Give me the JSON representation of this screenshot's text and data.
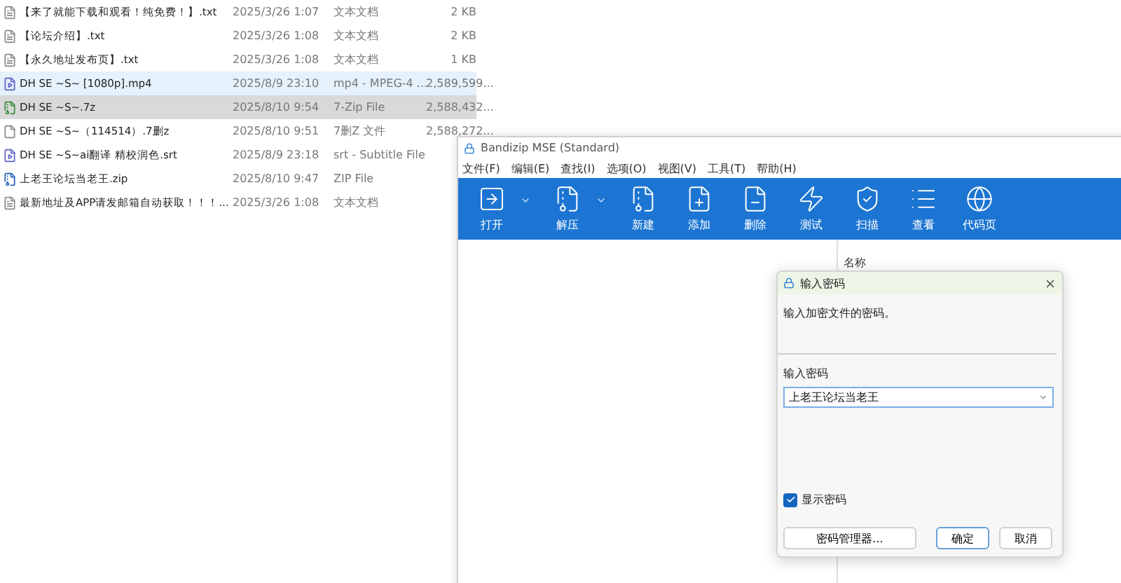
{
  "files": [
    {
      "kind": "text",
      "name": "【来了就能下载和观看！纯免费！】.txt",
      "date": "2025/3/26 1:07",
      "type": "文本文档",
      "size": "2 KB",
      "hovered": false,
      "selected": false
    },
    {
      "kind": "text",
      "name": "【论坛介绍】.txt",
      "date": "2025/3/26 1:08",
      "type": "文本文档",
      "size": "2 KB",
      "hovered": false,
      "selected": false
    },
    {
      "kind": "text",
      "name": "【永久地址发布页】.txt",
      "date": "2025/3/26 1:08",
      "type": "文本文档",
      "size": "1 KB",
      "hovered": false,
      "selected": false
    },
    {
      "kind": "video",
      "name": "DH SE ~S~ [1080p].mp4",
      "date": "2025/8/9 23:10",
      "type": "mp4 - MPEG-4 ...",
      "size": "2,589,599...",
      "hovered": true,
      "selected": false
    },
    {
      "kind": "archive",
      "name": "DH SE ~S~.7z",
      "date": "2025/8/10 9:54",
      "type": "7-Zip File",
      "size": "2,588,432...",
      "hovered": false,
      "selected": true
    },
    {
      "kind": "blank",
      "name": "DH SE ~S~（114514）.7删z",
      "date": "2025/8/10 9:51",
      "type": "7删Z 文件",
      "size": "2,588,272...",
      "hovered": false,
      "selected": false
    },
    {
      "kind": "video",
      "name": "DH SE ~S~ai翻译 精校润色.srt",
      "date": "2025/8/9 23:18",
      "type": "srt - Subtitle File",
      "hovered": false,
      "selected": false
    },
    {
      "kind": "zip",
      "name": "上老王论坛当老王.zip",
      "date": "2025/8/10 9:47",
      "type": "ZIP File",
      "hovered": false,
      "selected": false
    },
    {
      "kind": "text",
      "name": "最新地址及APP请发邮箱自动获取！！！...",
      "date": "2025/3/26 1:08",
      "type": "文本文档",
      "hovered": false,
      "selected": false
    }
  ],
  "bandizip": {
    "title": "Bandizip MSE (Standard)",
    "menu": [
      "文件(F)",
      "编辑(E)",
      "查找(I)",
      "选项(O)",
      "视图(V)",
      "工具(T)",
      "帮助(H)"
    ],
    "toolbar": [
      {
        "kind": "open",
        "label": "打开",
        "dropdown": true
      },
      {
        "kind": "extract",
        "label": "解压",
        "dropdown": true
      },
      {
        "kind": "new",
        "label": "新建",
        "dropdown": false
      },
      {
        "kind": "add",
        "label": "添加",
        "dropdown": false
      },
      {
        "kind": "delete",
        "label": "删除",
        "dropdown": false
      },
      {
        "kind": "test",
        "label": "测试",
        "dropdown": false
      },
      {
        "kind": "scan",
        "label": "扫描",
        "dropdown": false
      },
      {
        "kind": "view",
        "label": "查看",
        "dropdown": false
      },
      {
        "kind": "codepage",
        "label": "代码页",
        "dropdown": false
      }
    ],
    "column_header": "名称"
  },
  "dialog": {
    "title": "输入密码",
    "message": "输入加密文件的密码。",
    "field_label": "输入密码",
    "password": "上老王论坛当老王",
    "show_password": {
      "label": "显示密码",
      "checked": true
    },
    "buttons": [
      {
        "kind": "secondary",
        "label": "密码管理器..."
      },
      {
        "kind": "default",
        "label": "确定"
      },
      {
        "kind": "plain",
        "label": "取消"
      }
    ]
  }
}
